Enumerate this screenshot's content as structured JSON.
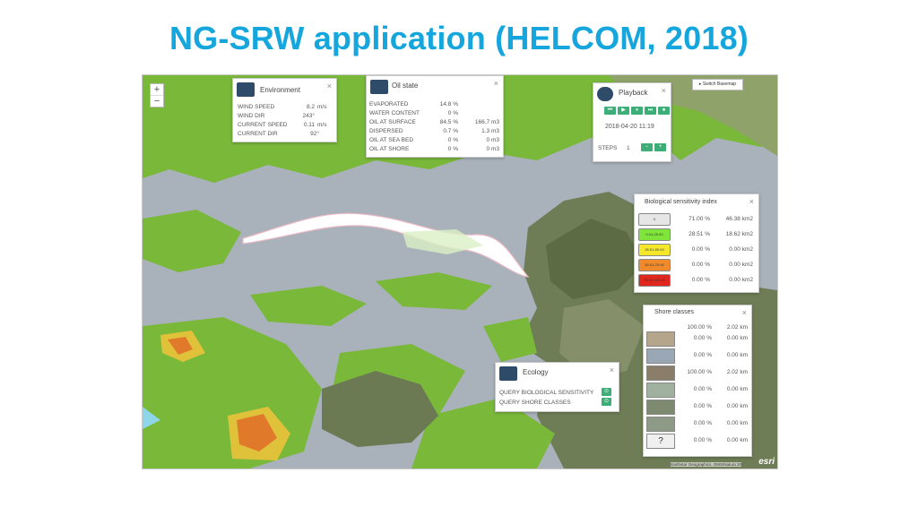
{
  "slide": {
    "title": "NG-SRW application (HELCOM, 2018)"
  },
  "map": {
    "zoom_in": "+",
    "zoom_out": "−",
    "switch_basemap": "▸ Switch Basemap",
    "attribution": "Earthstar Geographics, OMS/Natura 20",
    "logo": "esri"
  },
  "environment": {
    "title": "Environment",
    "close": "×",
    "rows": [
      {
        "label": "WIND SPEED",
        "value": "8.2",
        "unit": "m/s"
      },
      {
        "label": "WIND DIR",
        "value": "243°",
        "unit": ""
      },
      {
        "label": "CURRENT SPEED",
        "value": "0.11",
        "unit": "m/s"
      },
      {
        "label": "CURRENT DIR",
        "value": "92°",
        "unit": ""
      }
    ]
  },
  "oil_state": {
    "title": "Oil state",
    "close": "×",
    "rows": [
      {
        "label": "EVAPORATED",
        "pct": "14.8 %",
        "amount": ""
      },
      {
        "label": "WATER CONTENT",
        "pct": "0 %",
        "amount": ""
      },
      {
        "label": "OIL AT SURFACE",
        "pct": "84.5 %",
        "amount": "166.7  m3"
      },
      {
        "label": "DISPERSED",
        "pct": "0.7 %",
        "amount": "1.3  m3"
      },
      {
        "label": "OIL AT SEA BED",
        "pct": "0 %",
        "amount": "0  m3"
      },
      {
        "label": "OIL AT SHORE",
        "pct": "0 %",
        "amount": "0  m3"
      }
    ]
  },
  "playback": {
    "title": "Playback",
    "close": "×",
    "buttons": [
      "⏮",
      "▶",
      "⏸",
      "⏭",
      "⏹"
    ],
    "datetime": "2018-04-20 11:19",
    "steps_label": "STEPS",
    "steps_value": "1",
    "minus": "−",
    "plus": "+"
  },
  "bio_index": {
    "title": "Biological sensitivity index",
    "close": "×",
    "rows": [
      {
        "range": "0",
        "color": "#e6e6e6",
        "pct": "71.00 %",
        "area": "46.38 km2"
      },
      {
        "range": "0.01-25.00",
        "color": "#7fe53a",
        "pct": "28.51 %",
        "area": "18.62 km2"
      },
      {
        "range": "25.01-50.00",
        "color": "#f5e82b",
        "pct": "0.00 %",
        "area": "0.00 km2"
      },
      {
        "range": "50.01-75.00",
        "color": "#f08a2a",
        "pct": "0.00 %",
        "area": "0.00 km2"
      },
      {
        "range": "75.01-100.00",
        "color": "#e0261d",
        "pct": "0.00 %",
        "area": "0.00 km2"
      }
    ]
  },
  "shore_classes": {
    "title": "Shore classes",
    "close": "×",
    "header": {
      "pct": "100.00 %",
      "len": "2.02 km"
    },
    "rows": [
      {
        "icon": "",
        "pct": "0.00 %",
        "len": "0.00 km"
      },
      {
        "icon": "",
        "pct": "0.00 %",
        "len": "0.00 km"
      },
      {
        "icon": "",
        "pct": "100.00 %",
        "len": "2.02 km"
      },
      {
        "icon": "",
        "pct": "0.00 %",
        "len": "0.00 km"
      },
      {
        "icon": "",
        "pct": "0.00 %",
        "len": "0.00 km"
      },
      {
        "icon": "",
        "pct": "0.00 %",
        "len": "0.00 km"
      },
      {
        "icon": "?",
        "pct": "0.00 %",
        "len": "0.00 km"
      }
    ]
  },
  "ecology": {
    "title": "Ecology",
    "close": "×",
    "items": [
      {
        "label": "QUERY BIOLOGICAL SENSITIVITY",
        "btn": "⊙"
      },
      {
        "label": "QUERY SHORE CLASSES",
        "btn": "⊙"
      }
    ]
  }
}
